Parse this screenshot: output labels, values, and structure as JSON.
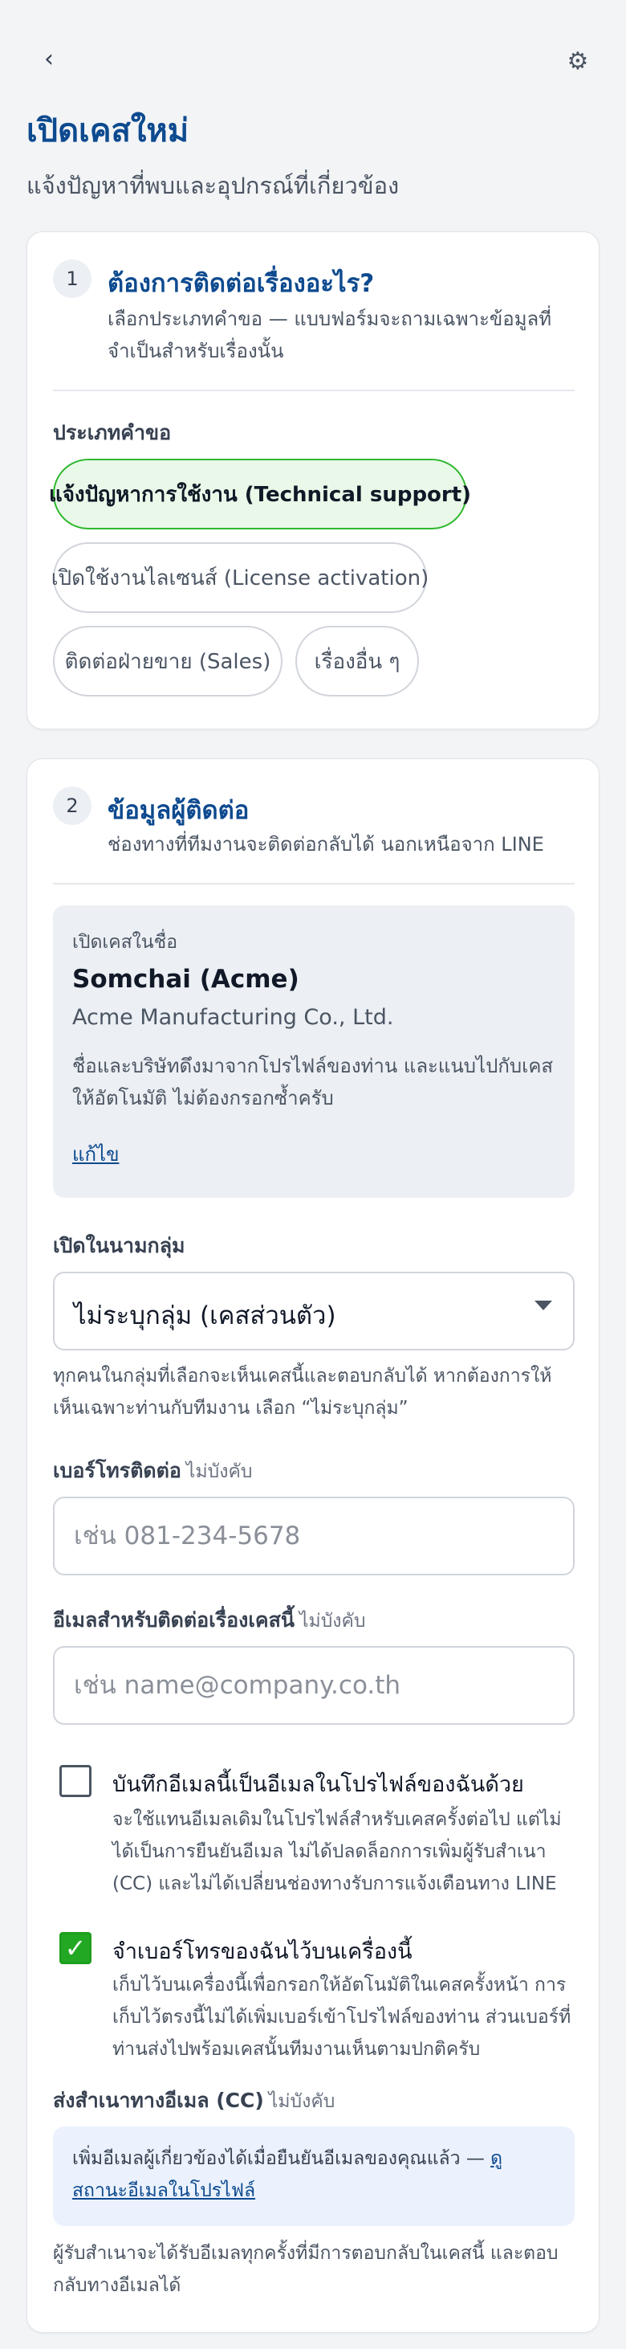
{
  "header": {
    "back_icon": "chevron-left-icon",
    "settings_icon": "gear-icon",
    "title": "เปิดเคสใหม่",
    "subtitle": "แจ้งปัญหาที่พบและอุปกรณ์ที่เกี่ยวข้อง"
  },
  "section1": {
    "step": "1",
    "title": "ต้องการติดต่อเรื่องอะไร?",
    "desc": "เลือกประเภทคำขอ — แบบฟอร์มจะถามเฉพาะข้อมูลที่จำเป็นสำหรับเรื่องนั้น",
    "field_label": "ประเภทคำขอ",
    "options": [
      {
        "label": "แจ้งปัญหาการใช้งาน (Technical support)",
        "selected": true
      },
      {
        "label": "เปิดใช้งานไลเซนส์ (License activation)",
        "selected": false
      },
      {
        "label": "ติดต่อฝ่ายขาย (Sales)",
        "selected": false
      },
      {
        "label": "เรื่องอื่น ๆ",
        "selected": false
      }
    ]
  },
  "section2": {
    "step": "2",
    "title": "ข้อมูลผู้ติดต่อ",
    "desc": "ช่องทางที่ทีมงานจะติดต่อกลับได้ นอกเหนือจาก LINE",
    "owner": {
      "caption": "เปิดเคสในชื่อ",
      "name": "Somchai (Acme)",
      "company": "Acme Manufacturing Co., Ltd.",
      "note": "ชื่อและบริษัทดึงมาจากโปรไฟล์ของท่าน และแนบไปกับเคสให้อัตโนมัติ ไม่ต้องกรอกซ้ำครับ",
      "edit_link": "แก้ไข"
    },
    "group": {
      "label": "เปิดในนามกลุ่ม",
      "value": "ไม่ระบุกลุ่ม (เคสส่วนตัว)",
      "help": "ทุกคนในกลุ่มที่เลือกจะเห็นเคสนี้และตอบกลับได้ หากต้องการให้เห็นเฉพาะท่านกับทีมงาน เลือก “ไม่ระบุกลุ่ม”"
    },
    "phone": {
      "label": "เบอร์โทรติดต่อ",
      "optional": "ไม่บังคับ",
      "value": "",
      "placeholder": "เช่น 081-234-5678"
    },
    "email": {
      "label": "อีเมลสำหรับติดต่อเรื่องเคสนี้",
      "optional": "ไม่บังคับ",
      "value": "",
      "placeholder": "เช่น name@company.co.th"
    },
    "save_email": {
      "checked": false,
      "label": "บันทึกอีเมลนี้เป็นอีเมลในโปรไฟล์ของฉันด้วย",
      "desc": "จะใช้แทนอีเมลเดิมในโปรไฟล์สำหรับเคสครั้งต่อไป แต่ไม่ได้เป็นการยืนยันอีเมล ไม่ได้ปลดล็อกการเพิ่มผู้รับสำเนา (CC) และไม่ได้เปลี่ยนช่องทางรับการแจ้งเตือนทาง LINE"
    },
    "remember_phone": {
      "checked": true,
      "check_glyph": "✓",
      "label": "จำเบอร์โทรของฉันไว้บนเครื่องนี้",
      "desc": "เก็บไว้บนเครื่องนี้เพื่อกรอกให้อัตโนมัติในเคสครั้งหน้า การเก็บไว้ตรงนี้ไม่ได้เพิ่มเบอร์เข้าโปรไฟล์ของท่าน ส่วนเบอร์ที่ท่านส่งไปพร้อมเคสนั้นทีมงานเห็นตามปกติครับ"
    },
    "cc": {
      "label": "ส่งสำเนาทางอีเมล (CC)",
      "optional": "ไม่บังคับ",
      "info_text": "เพิ่มอีเมลผู้เกี่ยวข้องได้เมื่อยืนยันอีเมลของคุณแล้ว — ",
      "info_link": "ดูสถานะอีเมลในโปรไฟล์",
      "help": "ผู้รับสำเนาจะได้รับอีเมลทุกครั้งที่มีการตอบกลับในเคสนี้ และตอบกลับทางอีเมลได้"
    }
  },
  "colors": {
    "title_blue": "#0d4a8f",
    "selected_green": "#2eb82e",
    "selected_bg": "#e9f8e8",
    "info_bg": "#ebf2fd"
  }
}
